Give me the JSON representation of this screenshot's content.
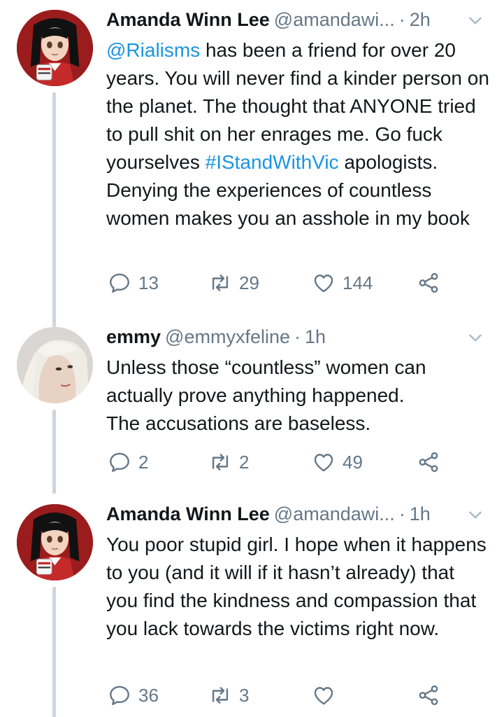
{
  "tweets": [
    {
      "name": "Amanda Winn Lee",
      "handle": "@amandawi...",
      "sep": "·",
      "time": "2h",
      "mention": "@Rialisms",
      "text_a": " has been a friend for over 20 years. You will never find a kinder person on the planet. The thought that ANYONE tried to pull shit on her enrages me. Go fuck yourselves ",
      "hashtag": "#IStandWithVic",
      "text_b": " apologists. Denying the experiences of countless women makes you an asshole in my book",
      "replies": "13",
      "retweets": "29",
      "likes": "144"
    },
    {
      "name": "emmy",
      "handle": "@emmyxfeline",
      "sep": "·",
      "time": "1h",
      "text": "Unless those “countless” women can actually prove anything happened.\nThe accusations are baseless.",
      "replies": "2",
      "retweets": "2",
      "likes": "49"
    },
    {
      "name": "Amanda Winn Lee",
      "handle": "@amandawi...",
      "sep": "·",
      "time": "1h",
      "text": "You poor stupid girl. I hope when it happens to you (and it will if it hasn’t already) that you find the kindness and compassion that you lack towards the victims right now.",
      "replies": "36",
      "retweets": "3",
      "likes": ""
    }
  ],
  "icons": {
    "reply": "reply-icon",
    "retweet": "retweet-icon",
    "like": "heart-icon",
    "share": "share-icon",
    "menu": "chevron-down-icon"
  },
  "colors": {
    "link": "#1b95e0",
    "muted": "#657786",
    "thread_line": "#ccd6dd"
  }
}
